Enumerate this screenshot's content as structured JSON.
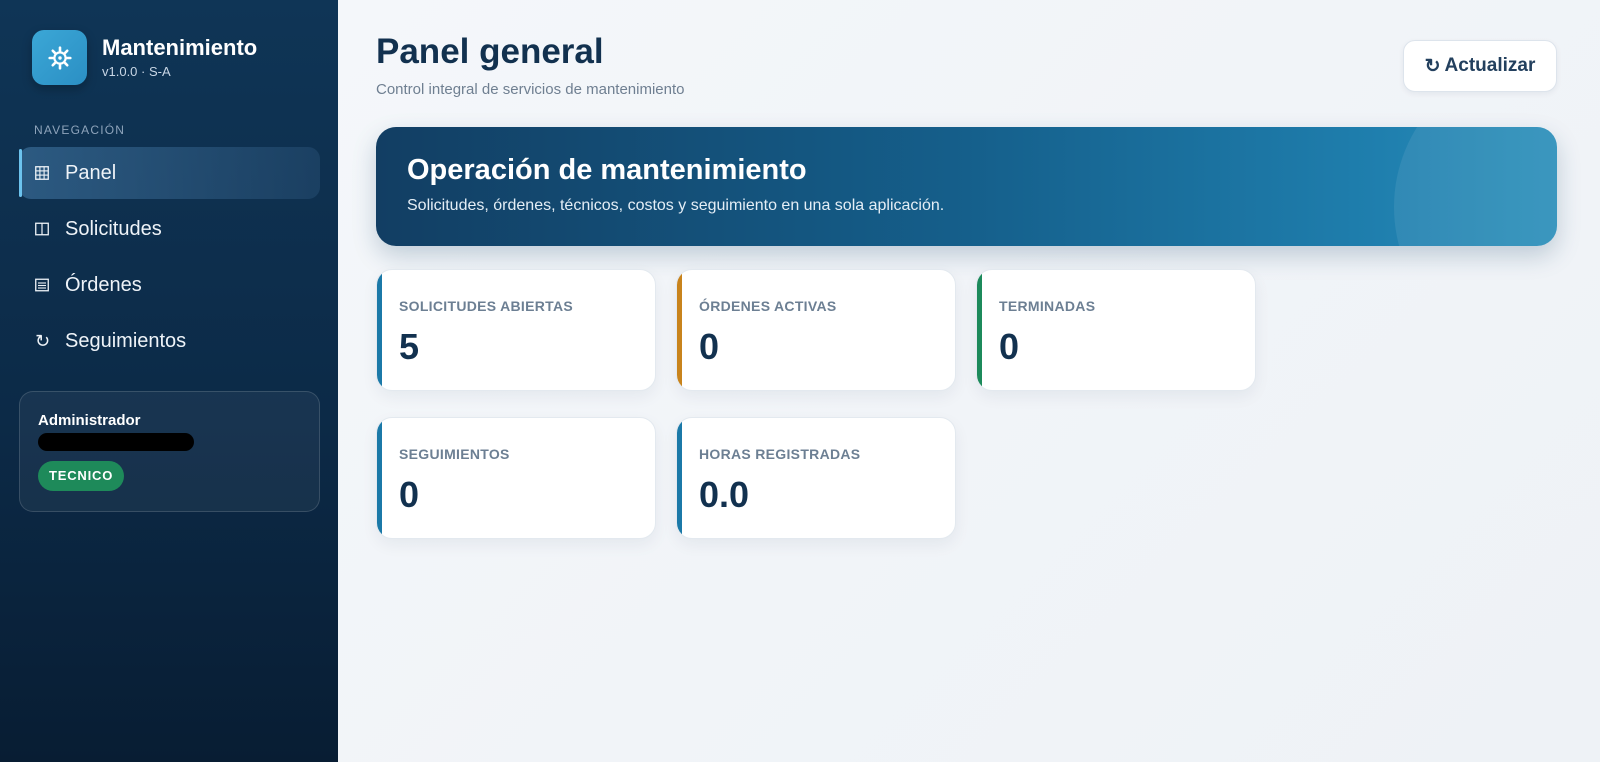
{
  "brand": {
    "name": "Mantenimiento",
    "version": "v1.0.0 · S-A",
    "icon": "gear-icon"
  },
  "nav": {
    "heading": "NAVEGACIÓN",
    "items": [
      {
        "label": "Panel",
        "icon": "grid-icon",
        "active": true
      },
      {
        "label": "Solicitudes",
        "icon": "book-icon",
        "active": false
      },
      {
        "label": "Órdenes",
        "icon": "list-icon",
        "active": false
      },
      {
        "label": "Seguimientos",
        "icon": "refresh-icon",
        "active": false
      }
    ]
  },
  "user": {
    "role": "Administrador",
    "badge": "TECNICO"
  },
  "header": {
    "title": "Panel general",
    "subtitle": "Control integral de servicios de mantenimiento",
    "refresh_label": "Actualizar",
    "refresh_icon": "↻"
  },
  "banner": {
    "title": "Operación de mantenimiento",
    "text": "Solicitudes, órdenes, técnicos, costos y seguimiento en una sola aplicación."
  },
  "stats": [
    {
      "label": "SOLICITUDES ABIERTAS",
      "value": "5",
      "color": "#1b79a8"
    },
    {
      "label": "ÓRDENES ACTIVAS",
      "value": "0",
      "color": "#c8831c"
    },
    {
      "label": "TERMINADAS",
      "value": "0",
      "color": "#1c8a5b"
    },
    {
      "label": "SEGUIMIENTOS",
      "value": "0",
      "color": "#1b79a8"
    },
    {
      "label": "HORAS REGISTRADAS",
      "value": "0.0",
      "color": "#1b79a8"
    }
  ],
  "colors": {
    "sidebar": "#0c2a47",
    "accent": "#2b8fc4",
    "badge": "#1e8a5a",
    "title": "#12314f"
  }
}
